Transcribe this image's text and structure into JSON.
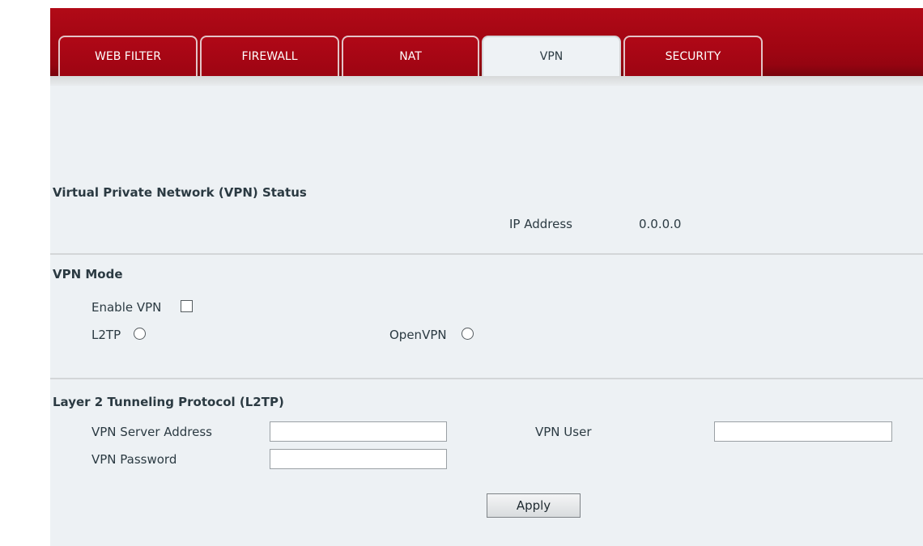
{
  "tabs": [
    {
      "label": "WEB FILTER",
      "active": false
    },
    {
      "label": "FIREWALL",
      "active": false
    },
    {
      "label": "NAT",
      "active": false
    },
    {
      "label": "VPN",
      "active": true
    },
    {
      "label": "SECURITY",
      "active": false
    }
  ],
  "status": {
    "title": "Virtual Private Network (VPN) Status",
    "ip_label": "IP Address",
    "ip_value": "0.0.0.0"
  },
  "mode": {
    "title": "VPN Mode",
    "enable_label": "Enable VPN",
    "enable_checked": false,
    "l2tp_label": "L2TP",
    "l2tp_selected": false,
    "openvpn_label": "OpenVPN",
    "openvpn_selected": false
  },
  "l2tp": {
    "title": "Layer 2 Tunneling Protocol (L2TP)",
    "server_label": "VPN Server Address",
    "server_value": "",
    "user_label": "VPN User",
    "user_value": "",
    "password_label": "VPN Password",
    "password_value": ""
  },
  "actions": {
    "apply_label": "Apply"
  },
  "colors": {
    "header_red": "#a00512",
    "content_bg": "#edf1f4",
    "active_tab_bg": "#eef2f5"
  }
}
